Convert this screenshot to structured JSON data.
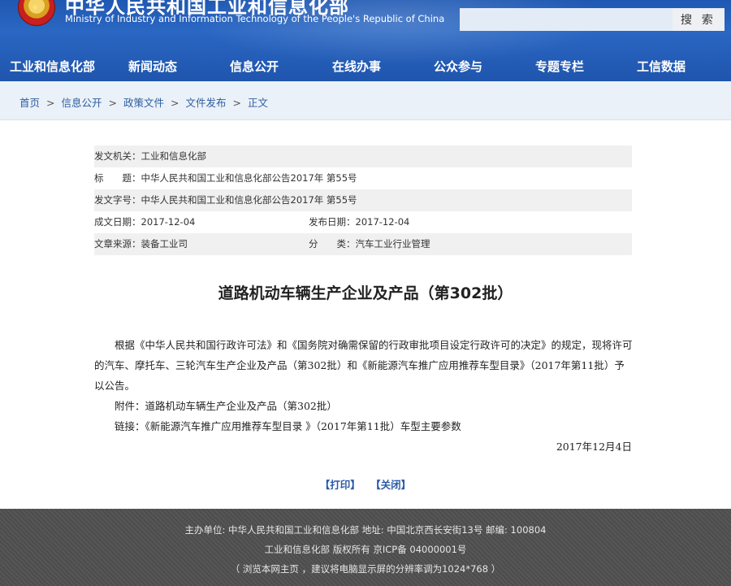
{
  "header": {
    "title": "中华人民共和国工业和信息化部",
    "subtitle": "Ministry of Industry and Information Technology of the People's Republic of China",
    "search_placeholder": "",
    "search_button": "搜 索"
  },
  "nav": [
    "工业和信息化部",
    "新闻动态",
    "信息公开",
    "在线办事",
    "公众参与",
    "专题专栏",
    "工信数据"
  ],
  "breadcrumb": [
    "首页",
    "信息公开",
    "政策文件",
    "文件发布",
    "正文"
  ],
  "breadcrumb_sep": ">",
  "meta": {
    "issuer": "发文机关：工业和信息化部",
    "title": "标　　题：中华人民共和国工业和信息化部公告2017年 第55号",
    "doc_no": "发文字号：中华人民共和国工业和信息化部公告2017年 第55号",
    "created": "成文日期：2017-12-04",
    "published": "发布日期：2017-12-04",
    "source": "文章来源：装备工业司",
    "category": "分　　类：汽车工业行业管理"
  },
  "document": {
    "title": "道路机动车辆生产企业及产品（第302批）",
    "paragraph": "根据《中华人民共和国行政许可法》和《国务院对确需保留的行政审批项目设定行政许可的决定》的规定，现将许可的汽车、摩托车、三轮汽车生产企业及产品（第302批）和《新能源汽车推广应用推荐车型目录》（2017年第11批）予以公告。",
    "attachment": "附件：道路机动车辆生产企业及产品（第302批）",
    "link": "链接：《新能源汽车推广应用推荐车型目录 》（2017年第11批）车型主要参数",
    "date": "2017年12月4日"
  },
  "actions": {
    "print": "【打印】",
    "close": "【关闭】"
  },
  "footer": {
    "line1": "主办单位: 中华人民共和国工业和信息化部 地址: 中国北京西长安街13号 邮编: 100804",
    "line2": "工业和信息化部 版权所有 京ICP备 04000001号",
    "line3": "（ 浏览本网主页 ，建议将电脑显示屏的分辨率调为1024*768 ）"
  }
}
